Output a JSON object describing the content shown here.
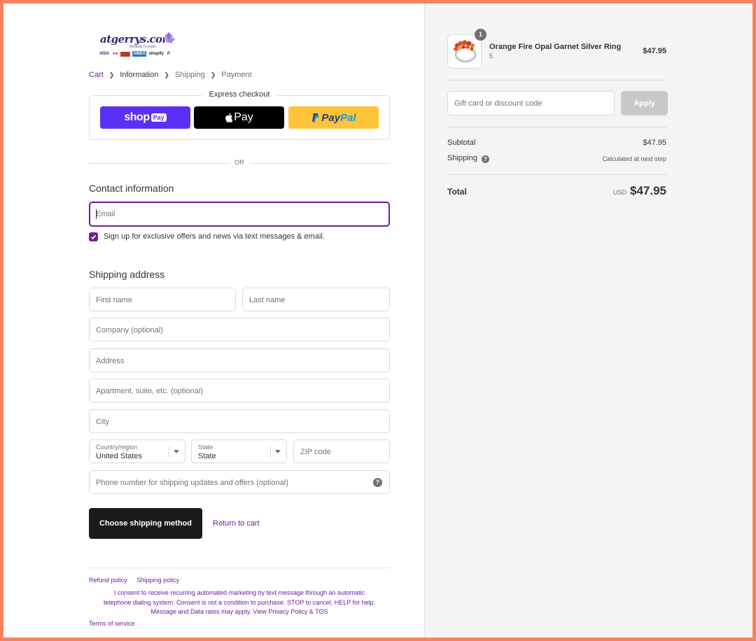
{
  "brand": {
    "logo_text": "atgerrys.com",
    "logo_tagline": "Booking Crystals",
    "card_labels": [
      "VISA",
      "●●",
      "AMEX",
      "shopify",
      "P"
    ]
  },
  "breadcrumb": {
    "cart": "Cart",
    "information": "Information",
    "shipping": "Shipping",
    "payment": "Payment"
  },
  "express": {
    "title": "Express checkout",
    "shop_pay_word": "shop",
    "shop_pay_pill": "Pay",
    "apple_pay": "Pay",
    "paypal_part1": "Pay",
    "paypal_part2": "Pal"
  },
  "or_text": "OR",
  "contact": {
    "title": "Contact information",
    "email_placeholder": "Email",
    "signup_label": "Sign up for exclusive offers and news via text messages & email."
  },
  "shipping_address": {
    "title": "Shipping address",
    "first_name": "First name",
    "last_name": "Last name",
    "company": "Company (optional)",
    "address": "Address",
    "apartment": "Apartment, suite, etc. (optional)",
    "city": "City",
    "country_label": "Country/region",
    "country_value": "United States",
    "state_label": "State",
    "state_value": "State",
    "zip": "ZIP code",
    "phone": "Phone number for shipping updates and offers (optional)"
  },
  "actions": {
    "continue_label": "Choose shipping method",
    "return_label": "Return to cart"
  },
  "footer": {
    "refund_policy": "Refund policy",
    "shipping_policy": "Shipping policy",
    "consent_line1": "I consent to receive recurring automated marketing by text message through an automatic",
    "consent_line2": "telephone dialing system. Consent is not a condition to purchase. STOP to cancel, HELP for help.",
    "consent_line3": "Message and Data rates may apply. View Privacy Policy & TOS",
    "terms": "Terms of service"
  },
  "order": {
    "quantity": "1",
    "product_name": "Orange Fire Opal Garnet Silver Ring",
    "variant": "5",
    "price": "$47.95",
    "discount_placeholder": "Gift card or discount code",
    "apply_label": "Apply",
    "subtotal_label": "Subtotal",
    "subtotal_value": "$47.95",
    "shipping_label": "Shipping",
    "shipping_value": "Calculated at next step",
    "total_label": "Total",
    "total_currency": "USD",
    "total_value": "$47.95"
  },
  "colors": {
    "accent": "#6b1e9e",
    "shop_pay": "#5a31f4",
    "paypal": "#ffc439",
    "frame": "#f6835f"
  }
}
